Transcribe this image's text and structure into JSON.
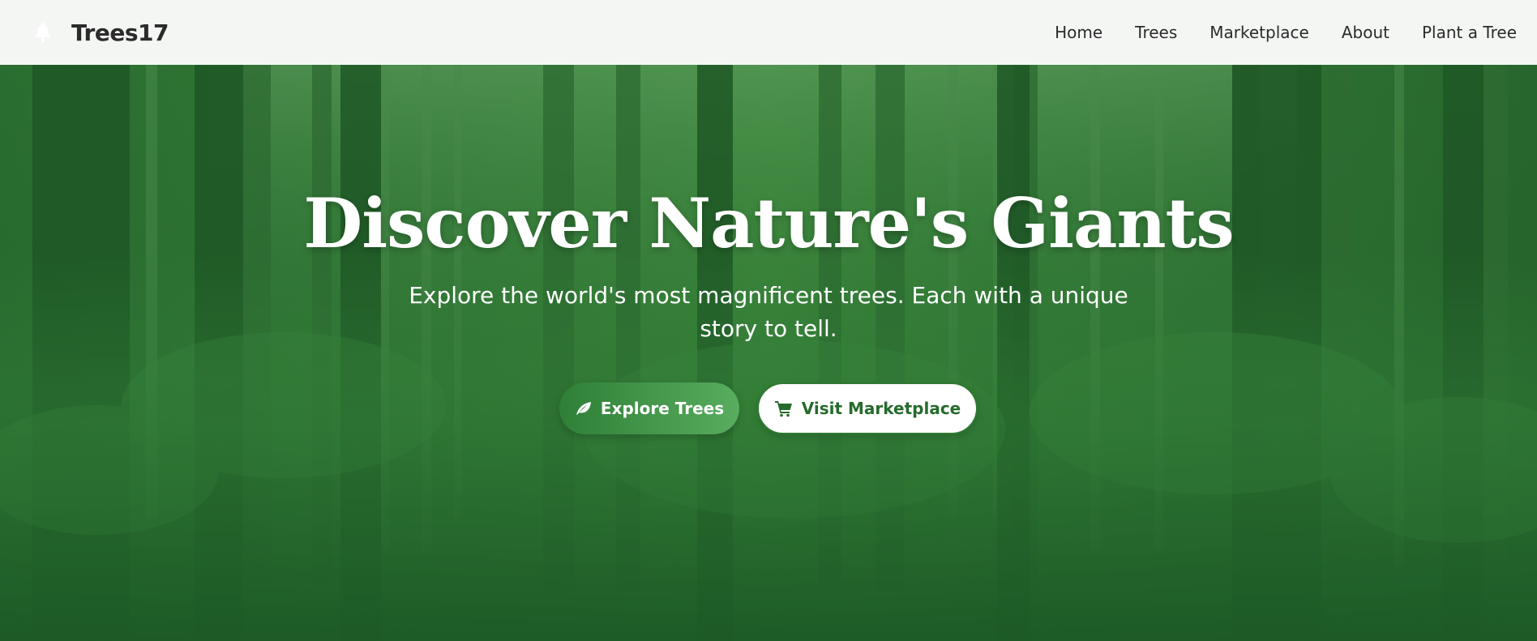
{
  "brand": {
    "name": "Trees17",
    "icon": "tree-icon"
  },
  "nav": {
    "items": [
      {
        "label": "Home"
      },
      {
        "label": "Trees"
      },
      {
        "label": "Marketplace"
      },
      {
        "label": "About"
      },
      {
        "label": "Plant a Tree"
      }
    ]
  },
  "hero": {
    "title": "Discover Nature's Giants",
    "subtitle": "Explore the world's most magnificent trees. Each with a unique story to tell.",
    "primary_button": {
      "label": "Explore Trees",
      "icon": "leaf-icon"
    },
    "secondary_button": {
      "label": "Visit Marketplace",
      "icon": "cart-icon"
    }
  },
  "colors": {
    "brand_green": "#2e7a34",
    "header_bg": "#f4f6f4",
    "text_dark": "#2b2b2b",
    "white": "#ffffff"
  }
}
